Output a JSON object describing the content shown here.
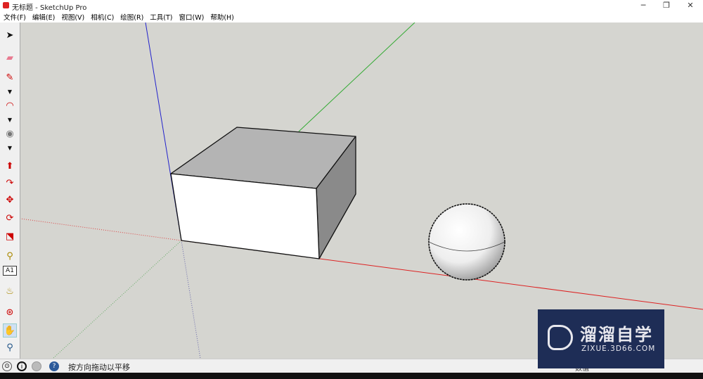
{
  "window": {
    "title": "无标题 - SketchUp Pro",
    "minimize": "─",
    "restore": "❐",
    "close": "✕"
  },
  "menu": [
    "文件(F)",
    "编辑(E)",
    "视图(V)",
    "相机(C)",
    "绘图(R)",
    "工具(T)",
    "窗口(W)",
    "帮助(H)"
  ],
  "tools": [
    {
      "name": "select-tool",
      "glyph": "➤",
      "color": "#111"
    },
    {
      "name": "eraser-tool",
      "glyph": "▰",
      "color": "#e87a90"
    },
    {
      "name": "pencil-tool",
      "glyph": "✎",
      "color": "#c00"
    },
    {
      "name": "line-dropdown",
      "glyph": "▼",
      "color": "#111"
    },
    {
      "name": "arc-tool",
      "glyph": "◠",
      "color": "#c00"
    },
    {
      "name": "arc-dropdown",
      "glyph": "▼",
      "color": "#111"
    },
    {
      "name": "shape-tool",
      "glyph": "◉",
      "color": "#777"
    },
    {
      "name": "shape-dropdown",
      "glyph": "▼",
      "color": "#111"
    },
    {
      "name": "push-pull-tool",
      "glyph": "⬆",
      "color": "#c00"
    },
    {
      "name": "follow-me-tool",
      "glyph": "↷",
      "color": "#c00"
    },
    {
      "name": "move-tool",
      "glyph": "✥",
      "color": "#c00"
    },
    {
      "name": "rotate-tool",
      "glyph": "⟳",
      "color": "#c00"
    },
    {
      "name": "scale-tool",
      "glyph": "⬔",
      "color": "#c00"
    },
    {
      "name": "tape-measure-tool",
      "glyph": "⚲",
      "color": "#a80"
    },
    {
      "name": "text-tool",
      "glyph": "A1",
      "color": "#111"
    },
    {
      "name": "paint-bucket-tool",
      "glyph": "♨",
      "color": "#a80"
    },
    {
      "name": "orbit-tool",
      "glyph": "⊛",
      "color": "#c00"
    },
    {
      "name": "pan-tool",
      "glyph": "✋",
      "color": "#333"
    },
    {
      "name": "zoom-tool",
      "glyph": "⚲",
      "color": "#258"
    }
  ],
  "status": {
    "text": "按方向拖动以平移",
    "vcb_label": "数值",
    "icons": [
      "geo-location",
      "credits",
      "user-account",
      "help"
    ]
  },
  "watermark": {
    "title": "溜溜自学",
    "url": "ZIXUE.3D66.COM"
  },
  "colors": {
    "canvas": "#d5d5d0",
    "x_axis": "#d22",
    "y_axis": "#2a2",
    "z_axis": "#22c"
  }
}
